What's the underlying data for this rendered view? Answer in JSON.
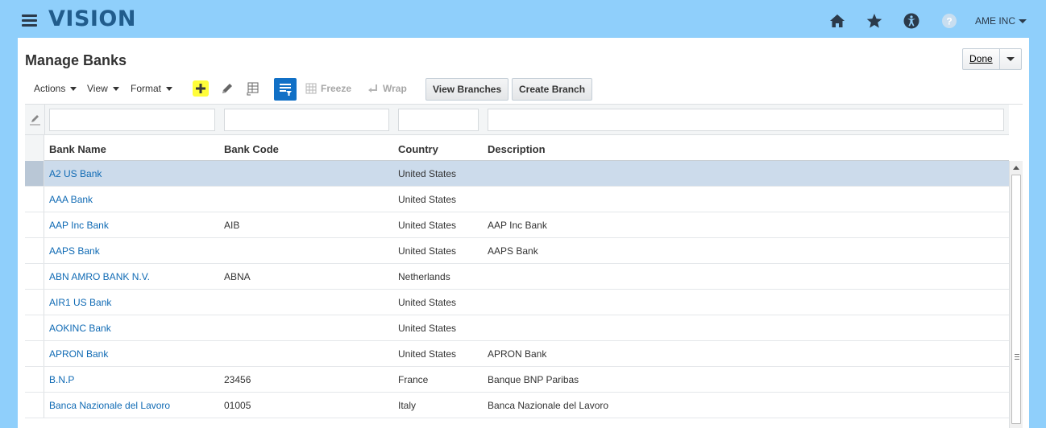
{
  "header": {
    "logo": "VISION",
    "user_label": "AME INC",
    "icons": [
      "home-icon",
      "star-icon",
      "accessibility-icon",
      "help-icon"
    ]
  },
  "page": {
    "title": "Manage Banks",
    "done_label": "Done"
  },
  "toolbar": {
    "actions_label": "Actions",
    "view_label": "View",
    "format_label": "Format",
    "freeze_label": "Freeze",
    "wrap_label": "Wrap",
    "view_branches_label": "View Branches",
    "create_branch_label": "Create Branch"
  },
  "table": {
    "columns": [
      "Bank Name",
      "Bank Code",
      "Country",
      "Description"
    ],
    "filters": {
      "name": "",
      "code": "",
      "country": "",
      "description": ""
    },
    "rows": [
      {
        "name": "A2 US Bank",
        "code": "",
        "country": "United States",
        "description": ""
      },
      {
        "name": "AAA Bank",
        "code": "",
        "country": "United States",
        "description": ""
      },
      {
        "name": "AAP Inc Bank",
        "code": "AIB",
        "country": "United States",
        "description": "AAP Inc Bank"
      },
      {
        "name": "AAPS Bank",
        "code": "",
        "country": "United States",
        "description": "AAPS Bank"
      },
      {
        "name": "ABN AMRO BANK N.V.",
        "code": "ABNA",
        "country": "Netherlands",
        "description": ""
      },
      {
        "name": "AIR1 US Bank",
        "code": "",
        "country": "United States",
        "description": ""
      },
      {
        "name": "AOKINC Bank",
        "code": "",
        "country": "United States",
        "description": ""
      },
      {
        "name": "APRON Bank",
        "code": "",
        "country": "United States",
        "description": "APRON Bank"
      },
      {
        "name": "B.N.P",
        "code": "23456",
        "country": "France",
        "description": "Banque BNP Paribas"
      },
      {
        "name": "Banca Nazionale del Lavoro",
        "code": "01005",
        "country": "Italy",
        "description": "Banca Nazionale del Lavoro"
      }
    ]
  },
  "colors": {
    "background": "#8fcffb",
    "link": "#0f6ab4",
    "selected_row": "#ccdbeb",
    "qbe_button": "#1170c6",
    "add_highlight": "#fffd3a"
  }
}
